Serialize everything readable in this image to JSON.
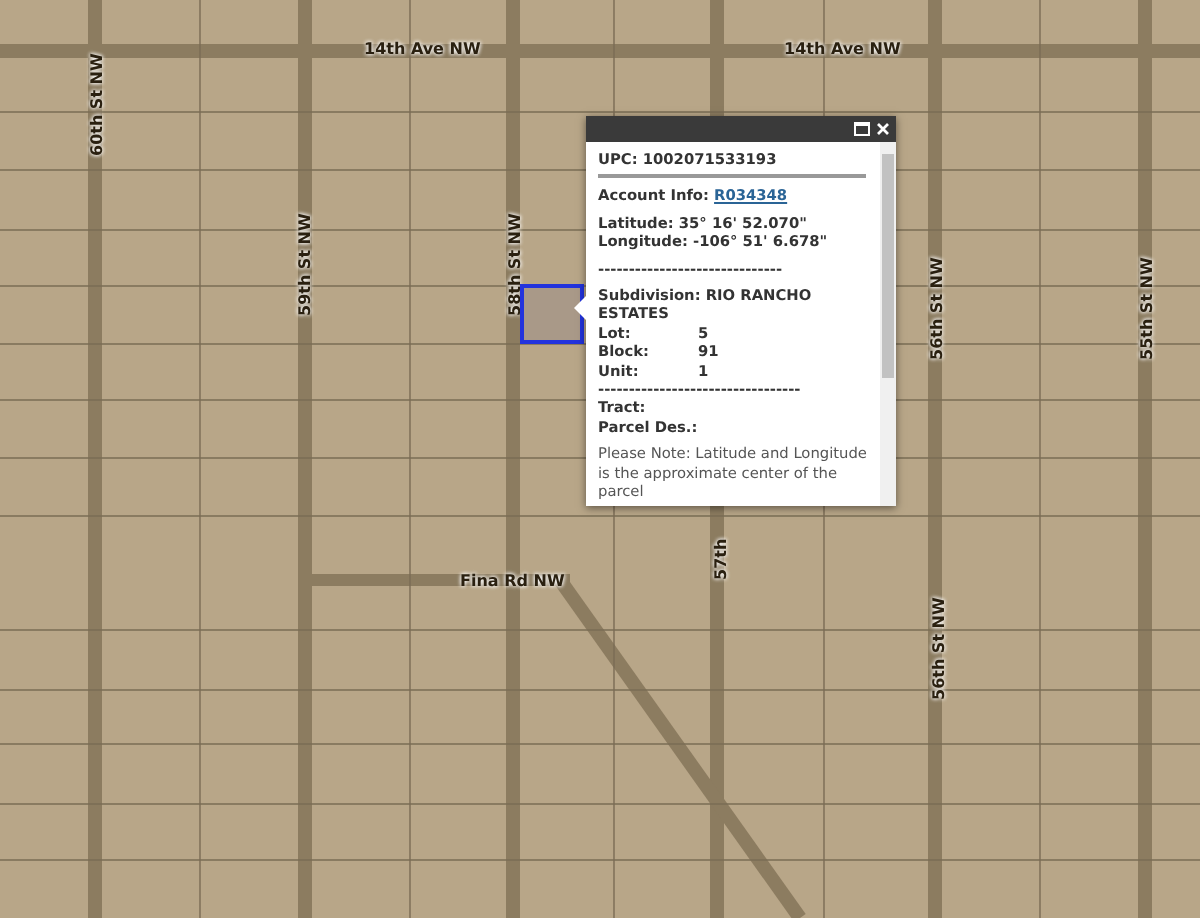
{
  "map": {
    "street_labels": [
      {
        "text": "14th Ave NW",
        "vertical": false
      },
      {
        "text": "14th Ave NW",
        "vertical": false
      },
      {
        "text": "60th St NW",
        "vertical": true
      },
      {
        "text": "59th St NW",
        "vertical": true
      },
      {
        "text": "58th St NW",
        "vertical": true
      },
      {
        "text": "56th St NW",
        "vertical": true
      },
      {
        "text": "55th St NW",
        "vertical": true
      },
      {
        "text": "Fina Rd NW",
        "vertical": false
      },
      {
        "text": "57th",
        "vertical": true
      },
      {
        "text": "56th St NW",
        "vertical": true
      }
    ]
  },
  "popup": {
    "groups": [
      [
        {
          "kind": "heading",
          "text": "UPC: 1002071533193"
        },
        {
          "kind": "rule"
        }
      ],
      [
        {
          "kind": "link",
          "label": "Account Info:",
          "link": "R034348"
        }
      ],
      [
        {
          "kind": "text",
          "text": "Latitude: 35° 16' 52.070\""
        },
        {
          "kind": "text",
          "text": "Longitude: -106° 51' 6.678\""
        }
      ],
      [
        {
          "kind": "text",
          "text": "------------------------------"
        }
      ],
      [
        {
          "kind": "text",
          "text": "Subdivision: RIO RANCHO ESTATES"
        },
        {
          "kind": "field",
          "label": "Lot:",
          "value": "5"
        },
        {
          "kind": "field",
          "label": "Block:",
          "value": "91"
        },
        {
          "kind": "field",
          "label": "Unit:",
          "value": "1"
        },
        {
          "kind": "text",
          "text": "---------------------------------"
        },
        {
          "kind": "text",
          "text": "Tract:"
        },
        {
          "kind": "text",
          "text": "Parcel Des.:"
        }
      ],
      [
        {
          "kind": "note",
          "text": "Please Note: Latitude and Longitude is the approximate center of the parcel"
        }
      ]
    ]
  }
}
